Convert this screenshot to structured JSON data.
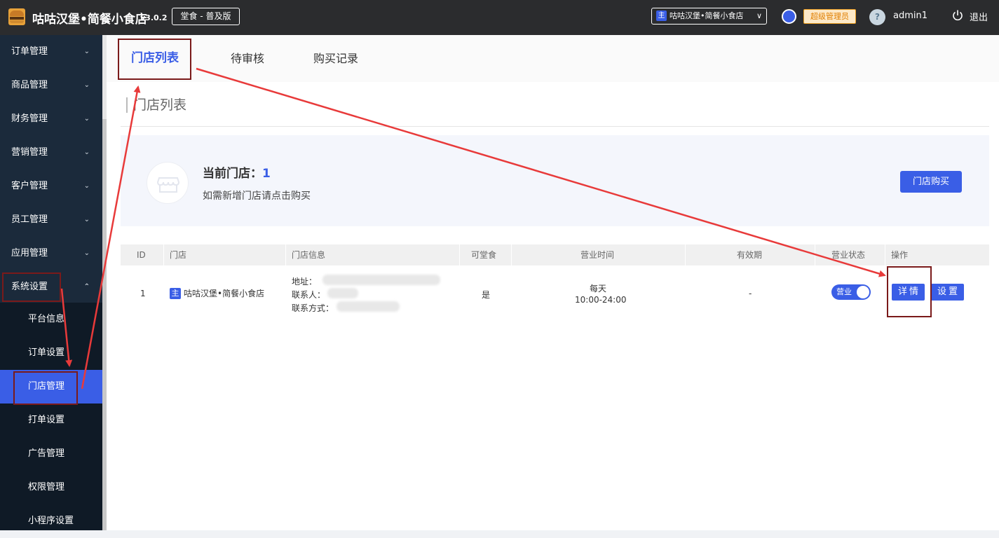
{
  "topbar": {
    "app_title": "咕咕汉堡•简餐小食店",
    "version": "v3.0.2",
    "edition": "堂食 - 普及版",
    "store_tag": "主",
    "store_select": "咕咕汉堡•简餐小食店",
    "role": "超级管理员",
    "avatar_glyph": "?",
    "username": "admin1",
    "logout": "退出"
  },
  "sidebar": {
    "items": [
      {
        "label": "订单管理"
      },
      {
        "label": "商品管理"
      },
      {
        "label": "财务管理"
      },
      {
        "label": "营销管理"
      },
      {
        "label": "客户管理"
      },
      {
        "label": "员工管理"
      },
      {
        "label": "应用管理"
      },
      {
        "label": "系统设置"
      }
    ],
    "sub_items": [
      {
        "label": "平台信息"
      },
      {
        "label": "订单设置"
      },
      {
        "label": "门店管理"
      },
      {
        "label": "打单设置"
      },
      {
        "label": "广告管理"
      },
      {
        "label": "权限管理"
      },
      {
        "label": "小程序设置"
      }
    ]
  },
  "tabs": [
    {
      "label": "门店列表"
    },
    {
      "label": "待审核"
    },
    {
      "label": "购买记录"
    }
  ],
  "section_title": "门店列表",
  "banner": {
    "title": "当前门店：",
    "count": "1",
    "desc": "如需新增门店请点击购买",
    "buy_button": "门店购买"
  },
  "table": {
    "headers": [
      "ID",
      "门店",
      "门店信息",
      "可堂食",
      "营业时间",
      "有效期",
      "营业状态",
      "操作"
    ],
    "rows": [
      {
        "id": "1",
        "store_tag": "主",
        "store_name": "咕咕汉堡•简餐小食店",
        "address_label": "地址：",
        "contact_label": "联系人：",
        "phone_label": "联系方式：",
        "dine_in": "是",
        "hours_days": "每天",
        "hours_time": "10:00-24:00",
        "validity": "-",
        "status": "营业",
        "detail_btn": "详情",
        "settings_btn": "设置"
      }
    ]
  },
  "colors": {
    "accent": "#3a5ee6",
    "sidebar_bg": "#1b2a3b",
    "topbar_bg": "#2b2c2e",
    "annotation_red": "#e83a3a",
    "highlight_box": "#7a1a1a"
  }
}
